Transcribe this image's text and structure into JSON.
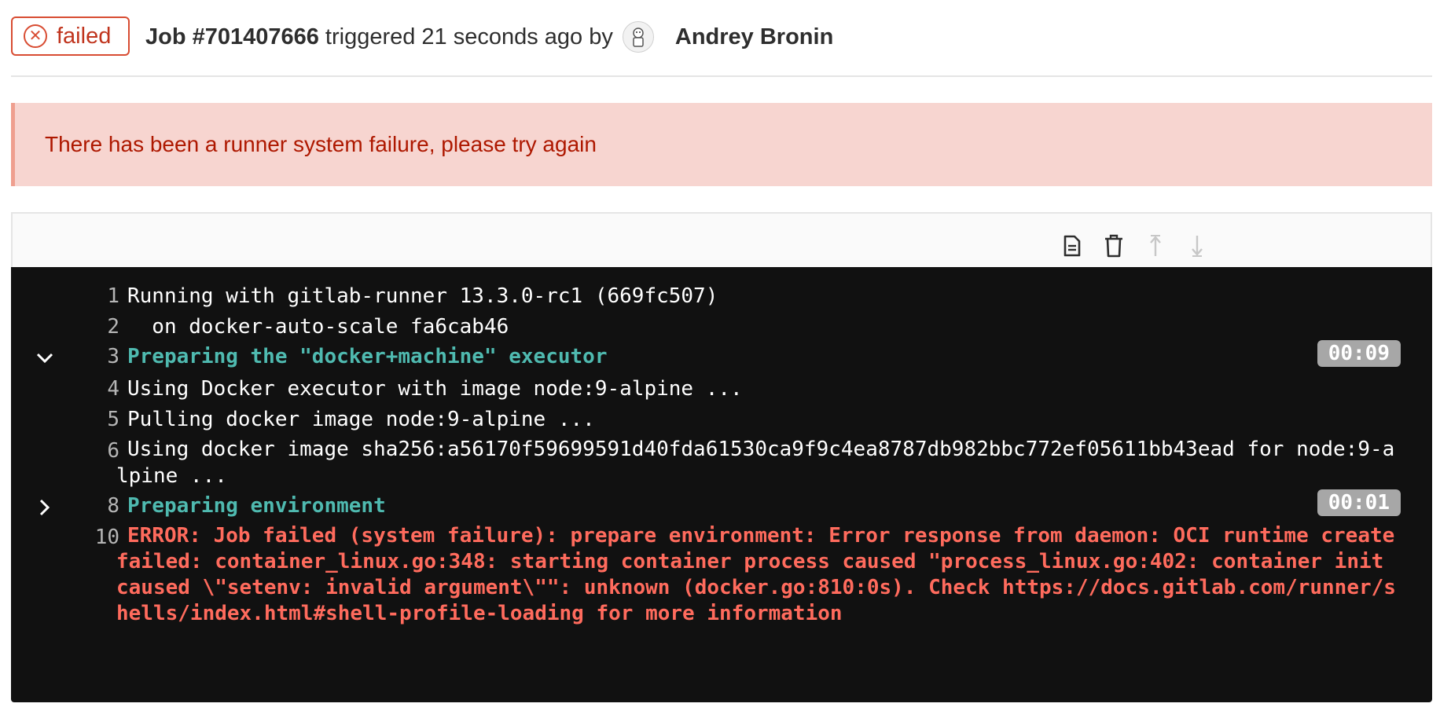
{
  "header": {
    "status_label": "failed",
    "job_id": "Job #701407666",
    "triggered_text": "triggered 21 seconds ago by",
    "author": "Andrey Bronin"
  },
  "alert": {
    "message": "There has been a runner system failure, please try again"
  },
  "toolbar": {
    "buttons": [
      {
        "icon": "doc-text-icon",
        "label": "Show complete raw"
      },
      {
        "icon": "trash-icon",
        "label": "Erase job log"
      },
      {
        "icon": "scroll-up-icon",
        "label": "Scroll to top"
      },
      {
        "icon": "scroll-down-icon",
        "label": "Scroll to bottom"
      }
    ]
  },
  "log": {
    "lines": [
      {
        "num": "1",
        "text": "Running with gitlab-runner 13.3.0-rc1 (669fc507)"
      },
      {
        "num": "2",
        "text": "  on docker-auto-scale fa6cab46"
      },
      {
        "num": "3",
        "text": "Preparing the \"docker+machine\" executor",
        "section": true,
        "toggle": "chevron-down",
        "duration": "00:09"
      },
      {
        "num": "4",
        "text": "Using Docker executor with image node:9-alpine ..."
      },
      {
        "num": "5",
        "text": "Pulling docker image node:9-alpine ..."
      },
      {
        "num": "6",
        "text": "Using docker image sha256:a56170f59699591d40fda61530ca9f9c4ea8787db982bbc772ef05611bb43ead for node:9-alpine ..."
      },
      {
        "num": "8",
        "text": "Preparing environment",
        "section": true,
        "toggle": "chevron-right",
        "duration": "00:01"
      },
      {
        "num": "10",
        "text": "ERROR: Job failed (system failure): prepare environment: Error response from daemon: OCI runtime create failed: container_linux.go:348: starting container process caused \"process_linux.go:402: container init caused \\\"setenv: invalid argument\\\"\": unknown (docker.go:810:0s). Check https://docs.gitlab.com/runner/shells/index.html#shell-profile-loading for more information",
        "error": true
      }
    ]
  },
  "colors": {
    "failed": "#d84c32",
    "alert_bg": "#f7d5d0",
    "alert_text": "#ae1800",
    "log_bg": "#111111",
    "section": "#4fbab0",
    "error": "#ff6b5d",
    "duration_bg": "#a7a7a7"
  }
}
